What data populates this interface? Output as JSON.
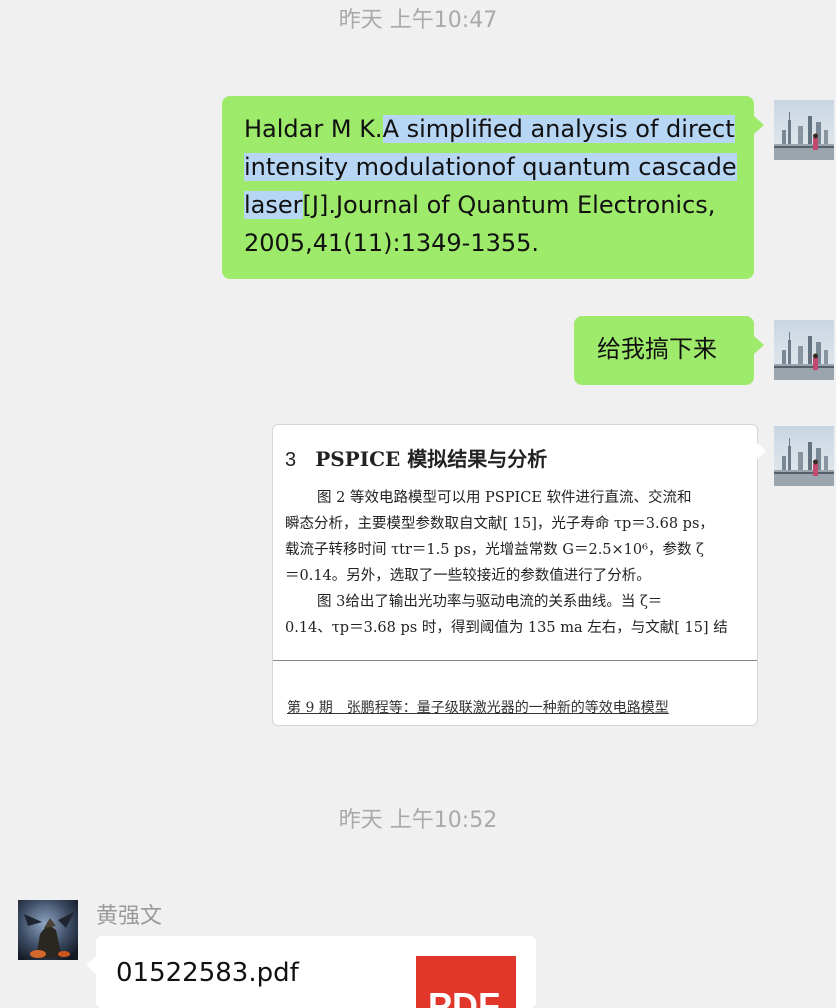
{
  "timestamps": [
    "昨天 上午10:47",
    "昨天 上午10:52"
  ],
  "messages": {
    "citation": {
      "lines": [
        {
          "plain": "Haldar M K.",
          "selected": "A simplified analysis of direct"
        },
        {
          "plain": "",
          "selected": "intensity modulationof quantum cascade"
        },
        {
          "selected": "laser",
          "plain": "[J].Journal of Quantum Electronics,"
        },
        {
          "plain": "2005,41(11):1349-1355.",
          "selected": ""
        }
      ]
    },
    "request": "给我搞下来",
    "image": {
      "heading_number": "3",
      "heading_title": "PSPICE 模拟结果与分析",
      "para1": [
        "图 2 等效电路模型可以用 PSPICE 软件进行直流、交流和",
        "瞬态分析，主要模型参数取自文献[ 15]，光子寿命 τp＝3.68 ps，",
        "载流子转移时间 τtr＝1.5 ps，光增益常数 G＝2.5×10⁶，参数 ζ",
        "＝0.14。另外，选取了一些较接近的参数值进行了分析。"
      ],
      "para2": [
        "图 3给出了输出光功率与驱动电流的关系曲线。当 ζ＝",
        "0.14、τp＝3.68 ps 时，得到阈值为 135 ma 左右，与文献[ 15] 结"
      ],
      "footer": "第 9 期　张鹏程等：量子级联激光器的一种新的等效电路模型"
    },
    "sender_name": "黄强文",
    "file": {
      "name": "01522583.pdf",
      "icon_label": "PDF",
      "icon_color": "#e0372a"
    }
  },
  "colors": {
    "chat_bg": "#f0f0f0",
    "own_bubble": "#9eea6a",
    "selection": "#b7d6f4",
    "timestamp": "#a9a9a9"
  }
}
